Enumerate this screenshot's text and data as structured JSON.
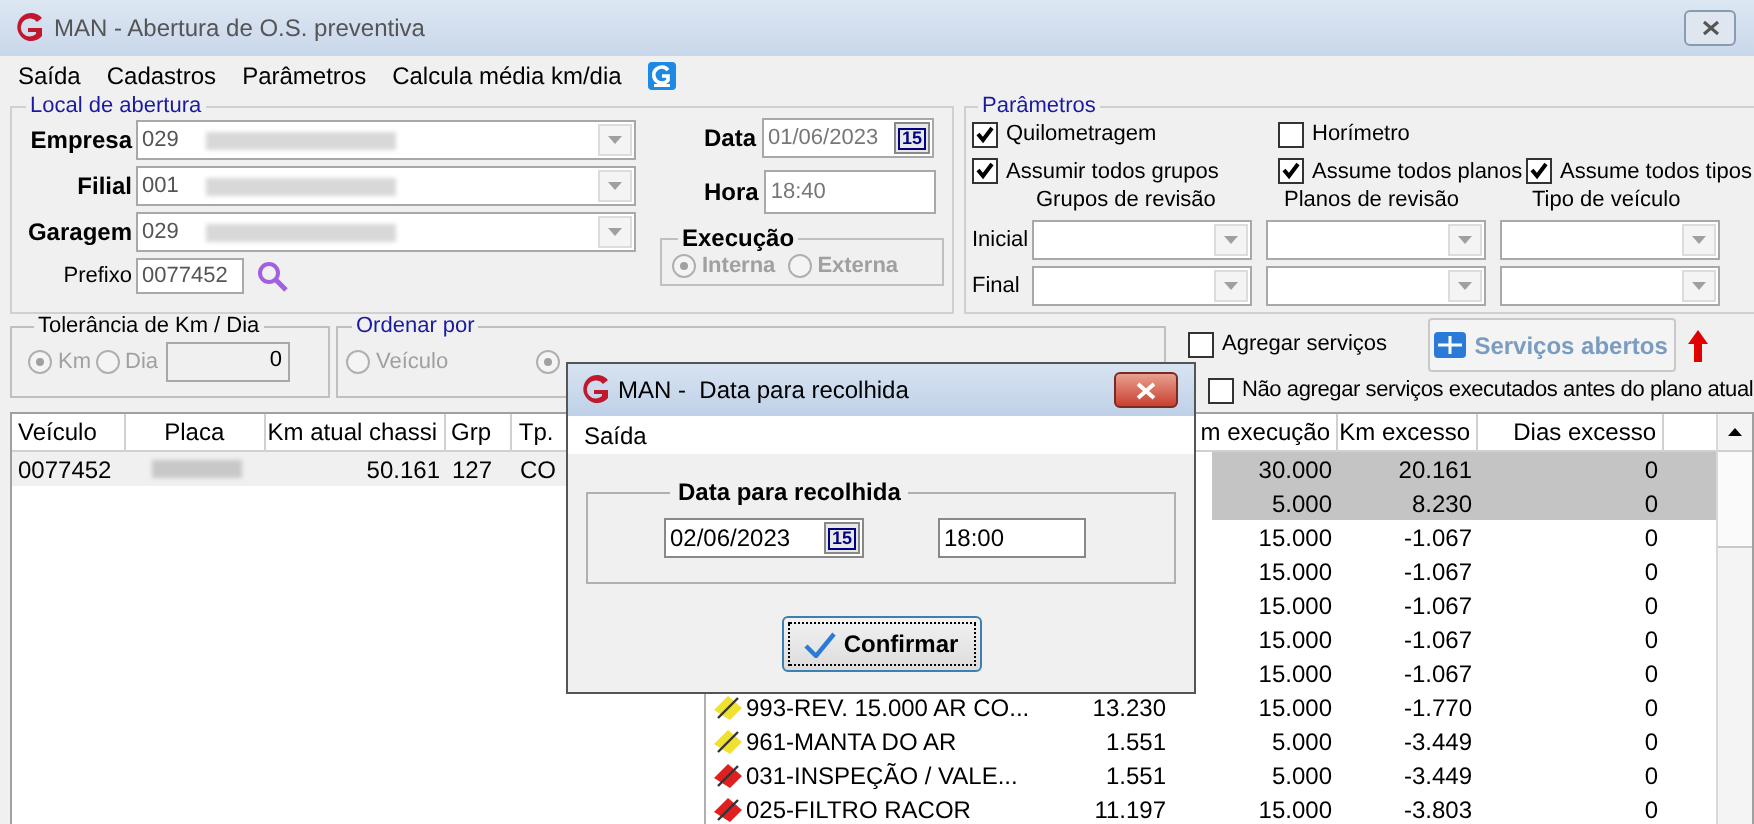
{
  "window": {
    "title": "MAN - Abertura de O.S. preventiva"
  },
  "menu": [
    "Saída",
    "Cadastros",
    "Parâmetros",
    "Calcula média km/dia"
  ],
  "local": {
    "title": "Local de abertura",
    "fields": [
      {
        "label": "Empresa",
        "value": "029"
      },
      {
        "label": "Filial",
        "value": "001"
      },
      {
        "label": "Garagem",
        "value": "029"
      }
    ],
    "prefixo": {
      "label": "Prefixo",
      "value": "0077452"
    },
    "data": {
      "label": "Data",
      "value": "01/06/2023",
      "calendar": "15"
    },
    "hora": {
      "label": "Hora",
      "value": "18:40"
    },
    "execucao": {
      "title": "Execução",
      "options": [
        {
          "label": "Interna",
          "selected": true
        },
        {
          "label": "Externa",
          "selected": false
        }
      ]
    }
  },
  "parametros": {
    "title": "Parâmetros",
    "checks": [
      {
        "label": "Quilometragem",
        "checked": true
      },
      {
        "label": "Horímetro",
        "checked": false
      },
      {
        "label": "Assumir todos grupos",
        "checked": true
      },
      {
        "label": "Assume todos planos",
        "checked": true
      },
      {
        "label": "Assume todos tipos",
        "checked": true
      }
    ],
    "columns": [
      "Grupos de revisão",
      "Planos de revisão",
      "Tipo de veículo"
    ],
    "rows": [
      "Inicial",
      "Final"
    ]
  },
  "tolerancia": {
    "title": "Tolerância de Km / Dia",
    "options": [
      {
        "label": "Km",
        "selected": true
      },
      {
        "label": "Dia",
        "selected": false
      }
    ],
    "value": "0"
  },
  "ordenar": {
    "title": "Ordenar por",
    "options": [
      {
        "label": "Veículo",
        "selected": false
      },
      {
        "selected": true
      }
    ]
  },
  "agregar": {
    "label": "Agregar serviços",
    "checked": false
  },
  "servicos_button": "Serviços abertos",
  "nao_agregar": {
    "label": "Não agregar serviços executados antes do plano atual",
    "checked": false
  },
  "vehicles": {
    "columns": [
      "Veículo",
      "Placa",
      "Km atual chassi",
      "Grp",
      "Tp."
    ],
    "rows": [
      {
        "veiculo": "0077452",
        "km": "50.161",
        "grp": "127",
        "tp": "CO",
        "selected": true
      }
    ]
  },
  "services": {
    "columns": [
      "m execução",
      "Km excesso",
      "Dias excesso"
    ],
    "rows": [
      {
        "exec": "30.000",
        "excesso": "20.161",
        "dias": "0",
        "selected": true
      },
      {
        "exec": "5.000",
        "excesso": "8.230",
        "dias": "0",
        "selected": true
      },
      {
        "exec": "15.000",
        "excesso": "-1.067",
        "dias": "0",
        "selected": false
      },
      {
        "exec": "15.000",
        "excesso": "-1.067",
        "dias": "0",
        "selected": false
      },
      {
        "exec": "15.000",
        "excesso": "-1.067",
        "dias": "0",
        "selected": false
      },
      {
        "exec": "15.000",
        "excesso": "-1.067",
        "dias": "0",
        "selected": false
      },
      {
        "exec": "15.000",
        "excesso": "-1.067",
        "dias": "0",
        "selected": false
      },
      {
        "name": "993-REV. 15.000 AR CO...",
        "color": "#f0e030",
        "km": "13.230",
        "exec": "15.000",
        "excesso": "-1.770",
        "dias": "0",
        "selected": false
      },
      {
        "name": "961-MANTA DO AR",
        "color": "#f0e030",
        "km": "1.551",
        "exec": "5.000",
        "excesso": "-3.449",
        "dias": "0",
        "selected": false
      },
      {
        "name": "031-INSPEÇÃO / VALE...",
        "color": "#e02020",
        "km": "1.551",
        "exec": "5.000",
        "excesso": "-3.449",
        "dias": "0",
        "selected": false
      },
      {
        "name": "025-FILTRO RACOR",
        "color": "#e02020",
        "km": "11.197",
        "exec": "15.000",
        "excesso": "-3.803",
        "dias": "0",
        "selected": false
      }
    ]
  },
  "dialog": {
    "title": "MAN -  Data para recolhida",
    "menu": "Saída",
    "group": "Data para recolhida",
    "date": "02/06/2023",
    "calendar": "15",
    "time": "18:00",
    "button": "Confirmar"
  }
}
